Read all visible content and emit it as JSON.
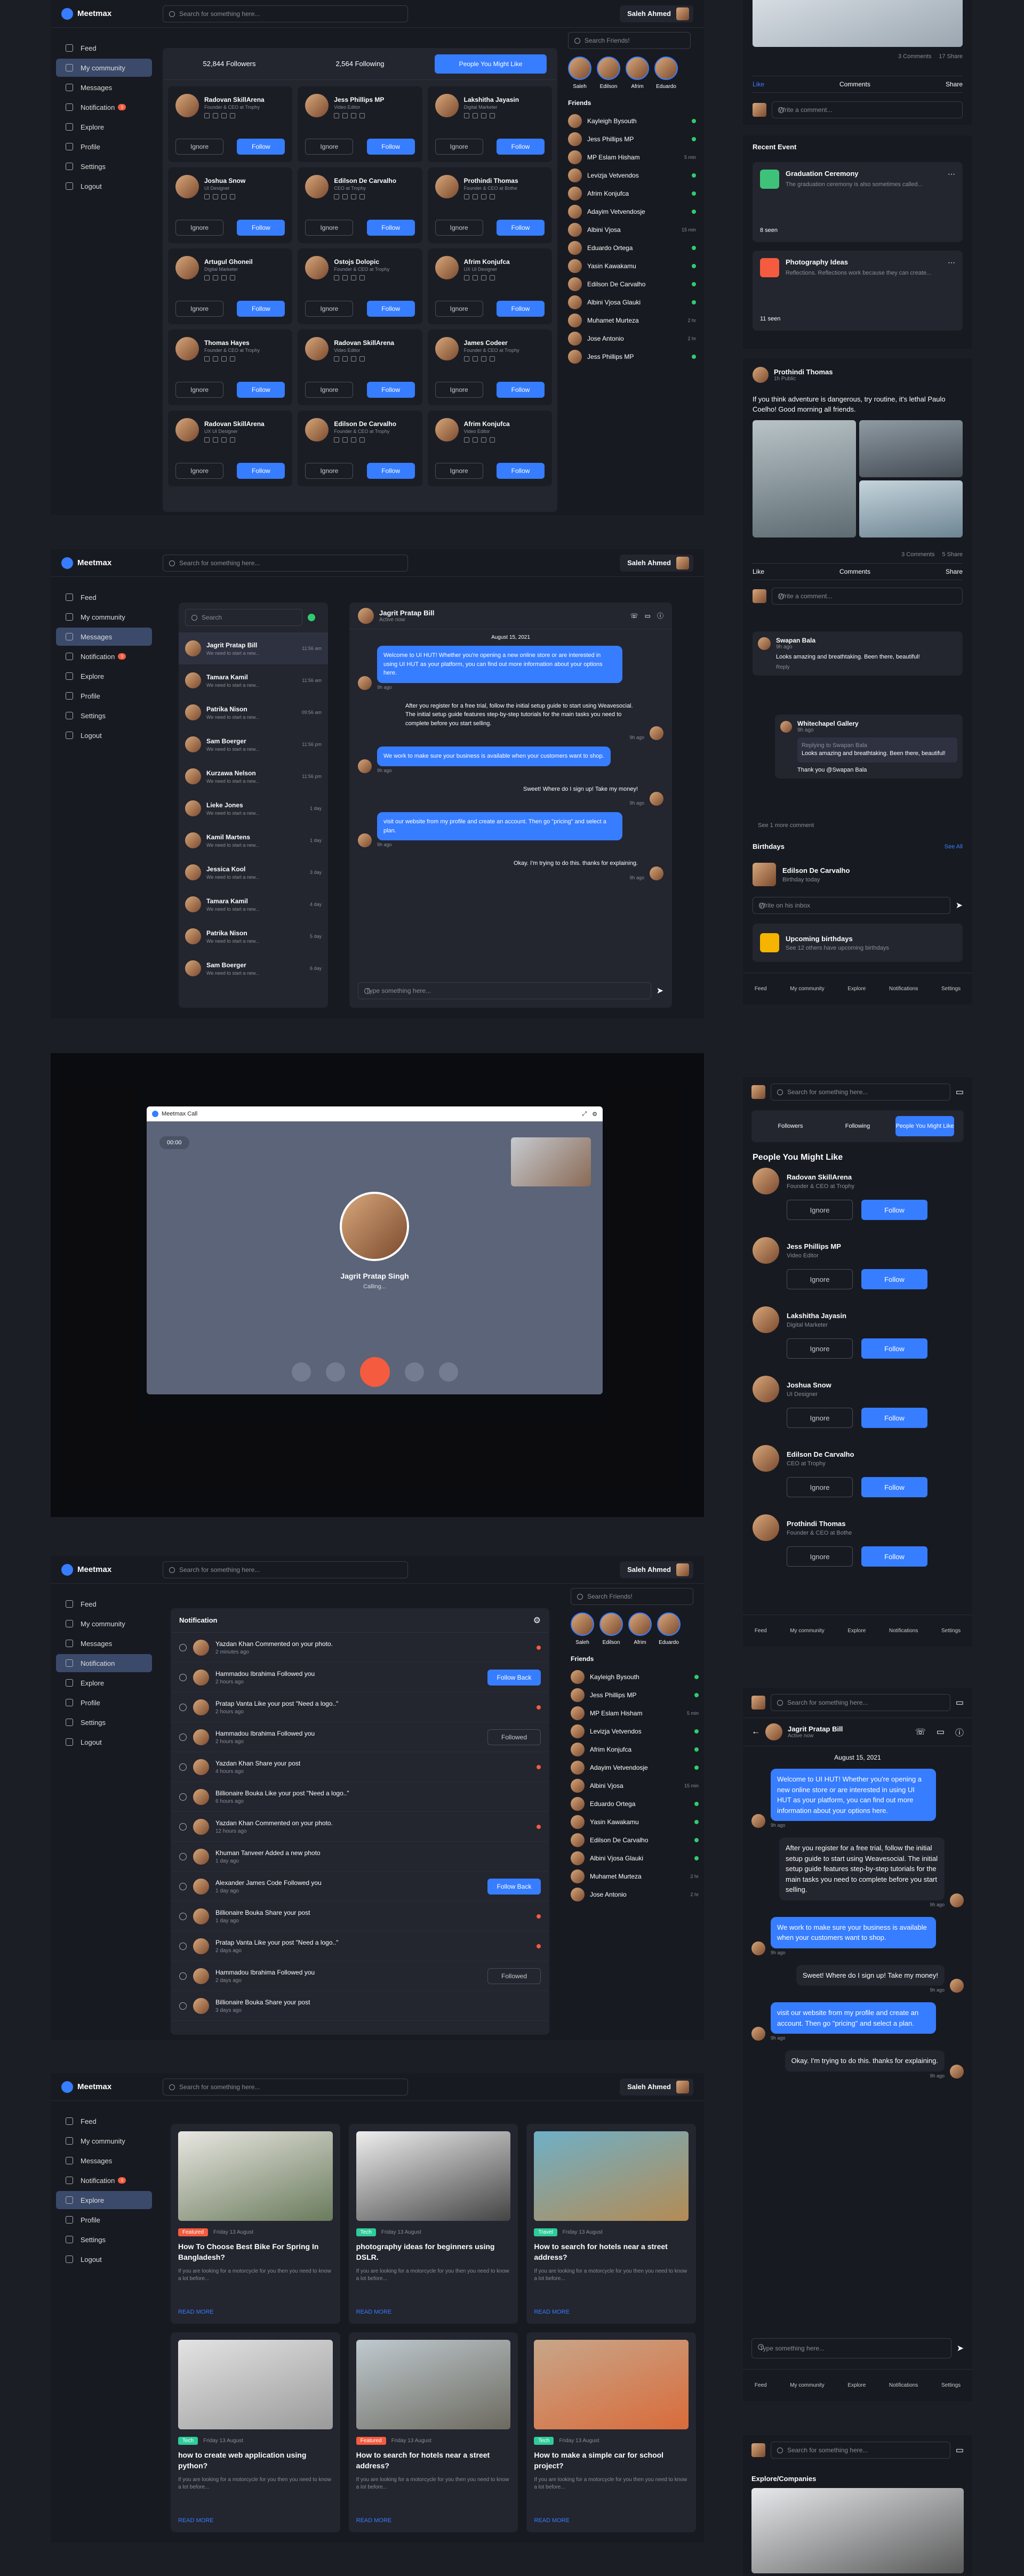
{
  "app": {
    "name": "Meetmax",
    "user": "Saleh Ahmed",
    "search_placeholder": "Search for something here...",
    "friends_placeholder": "Search Friends!"
  },
  "sidebar": [
    {
      "label": "Feed"
    },
    {
      "label": "My community"
    },
    {
      "label": "Messages"
    },
    {
      "label": "Notification"
    },
    {
      "label": "Explore"
    },
    {
      "label": "Profile"
    },
    {
      "label": "Settings"
    },
    {
      "label": "Logout"
    }
  ],
  "notif_badge": "9",
  "community": {
    "followers": "52,844 Followers",
    "following": "2,564 Following",
    "might_like": "People You Might Like",
    "ignore": "Ignore",
    "follow": "Follow",
    "people": [
      {
        "name": "Radovan SkillArena",
        "role": "Founder & CEO at Trophy"
      },
      {
        "name": "Jess Phillips MP",
        "role": "Video Editor"
      },
      {
        "name": "Lakshitha Jayasin",
        "role": "Digital Marketer"
      },
      {
        "name": "Joshua Snow",
        "role": "UI Designer"
      },
      {
        "name": "Edilson De Carvalho",
        "role": "CEO at Trophy"
      },
      {
        "name": "Prothindi Thomas",
        "role": "Founder & CEO at Bothe"
      },
      {
        "name": "Artugul Ghoneil",
        "role": "Digital Marketer"
      },
      {
        "name": "Ostojs Dolopic",
        "role": "Founder & CEO at Trophy"
      },
      {
        "name": "Afrim Konjufca",
        "role": "UX UI Designer"
      },
      {
        "name": "Thomas Hayes",
        "role": "Founder & CEO at Trophy"
      },
      {
        "name": "Radovan SkillArena",
        "role": "Video Editor"
      },
      {
        "name": "James Codeer",
        "role": "Founder & CEO at Trophy"
      },
      {
        "name": "Radovan SkillArena",
        "role": "UX UI Designer"
      },
      {
        "name": "Edilson De Carvalho",
        "role": "Founder & CEO at Trophy"
      },
      {
        "name": "Afrim Konjufca",
        "role": "Video Editor"
      }
    ]
  },
  "stories": [
    {
      "name": "Saleh"
    },
    {
      "name": "Edilson"
    },
    {
      "name": "Afrim"
    },
    {
      "name": "Eduardo"
    }
  ],
  "friends_title": "Friends",
  "friends": [
    {
      "name": "Kayleigh Bysouth",
      "t": ""
    },
    {
      "name": "Jess Phillips MP",
      "t": ""
    },
    {
      "name": "MP Eslam Hisham",
      "t": "5 min"
    },
    {
      "name": "Levizja Vetvendos",
      "t": ""
    },
    {
      "name": "Afrim Konjufca",
      "t": ""
    },
    {
      "name": "Adayim Vetvendosje",
      "t": ""
    },
    {
      "name": "Albini Vjosa",
      "t": "15 min"
    },
    {
      "name": "Eduardo Ortega",
      "t": ""
    },
    {
      "name": "Yasin Kawakamu",
      "t": ""
    },
    {
      "name": "Edilson De Carvalho",
      "t": ""
    },
    {
      "name": "Albini Vjosa Glauki",
      "t": ""
    },
    {
      "name": "Muhamet Murteza",
      "t": "2 hr"
    },
    {
      "name": "Jose Antonio",
      "t": "2 hr"
    },
    {
      "name": "Jess Phillips MP",
      "t": ""
    }
  ],
  "messages": {
    "search": "Search",
    "contact": "Jagrit Pratap Bill",
    "status": "Active now",
    "date": "August 15, 2021",
    "input": "Type something here...",
    "list": [
      {
        "name": "Jagrit Pratap Bill",
        "t": "11:56 am"
      },
      {
        "name": "Tamara Kamil",
        "t": "11:56 am"
      },
      {
        "name": "Patrika Nison",
        "t": "09:56 am"
      },
      {
        "name": "Sam Boerger",
        "t": "11:56 pm"
      },
      {
        "name": "Kurzawa Nelson",
        "t": "11:56 pm"
      },
      {
        "name": "Lieke Jones",
        "t": "1 day"
      },
      {
        "name": "Kamil Martens",
        "t": "1 day"
      },
      {
        "name": "Jessica Kool",
        "t": "3 day"
      },
      {
        "name": "Tamara Kamil",
        "t": "4 day"
      },
      {
        "name": "Patrika Nison",
        "t": "5 day"
      },
      {
        "name": "Sam Boerger",
        "t": "6 day"
      }
    ],
    "preview": "We need to start a new...",
    "chat": [
      {
        "me": false,
        "text": "Welcome to UI HUT! Whether you're opening a new online store or are interested in using UI HUT as your platform, you can find out more information about your options here.",
        "t": "9h ago"
      },
      {
        "me": true,
        "text": "After you register for a free trial, follow the initial setup guide to start using Weavesocial. The initial setup guide features step-by-step tutorials for the main tasks you need to complete before you start selling.",
        "t": "9h ago"
      },
      {
        "me": false,
        "text": "We work to make sure your business is available when your customers want to shop.",
        "t": "9h ago"
      },
      {
        "me": true,
        "text": "Sweet! Where do I sign up! Take my money!",
        "t": "9h ago"
      },
      {
        "me": false,
        "text": "visit our website from my profile and create an account. Then go \"pricing\" and select a plan.",
        "t": "9h ago"
      },
      {
        "me": true,
        "text": "Okay. I'm trying to do this. thanks for explaining.",
        "t": "9h ago"
      }
    ]
  },
  "call": {
    "title": "Meetmax Call",
    "timer": "00:00",
    "name": "Jagrit Pratap Singh",
    "status": "Calling..."
  },
  "notifications": {
    "title": "Notification",
    "follow_back": "Follow Back",
    "followed": "Followed",
    "items": [
      {
        "text": "Yazdan Khan Commented on your photo.",
        "t": "2 minutes ago"
      },
      {
        "text": "Hammadou Ibrahima Followed you",
        "t": "2 hours ago"
      },
      {
        "text": "Pratap Vanta Like your post \"Need a logo..\"",
        "t": "2 hours ago"
      },
      {
        "text": "Hammadou Ibrahima Followed you",
        "t": "2 hours ago"
      },
      {
        "text": "Yazdan Khan Share your post",
        "t": "4 hours ago"
      },
      {
        "text": "Billionaire Bouka Like your post \"Need a logo..\"",
        "t": "6 hours ago"
      },
      {
        "text": "Yazdan Khan Commented on your photo.",
        "t": "12 hours ago"
      },
      {
        "text": "Khuman Tanveer Added a new photo",
        "t": "1 day ago"
      },
      {
        "text": "Alexander James Code Followed you",
        "t": "1 day ago"
      },
      {
        "text": "Billionaire Bouka Share your post",
        "t": "1 day ago"
      },
      {
        "text": "Pratap Vanta Like your post \"Need a logo..\"",
        "t": "2 days ago"
      },
      {
        "text": "Hammadou Ibrahima Followed you",
        "t": "2 days ago"
      },
      {
        "text": "Billionaire Bouka Share your post",
        "t": "3 days ago"
      }
    ]
  },
  "explore": {
    "read_more": "READ MORE",
    "date": "Friday 13 August",
    "articles": [
      {
        "tag": "Featured",
        "title": "How To Choose Best Bike For Spring In Bangladesh?"
      },
      {
        "tag": "Tech",
        "title": "photography ideas for beginners using DSLR."
      },
      {
        "tag": "Travel",
        "title": "How to search for hotels near a street address?"
      },
      {
        "tag": "Tech",
        "title": "how to create web application using python?"
      },
      {
        "tag": "Featured",
        "title": "How to search for hotels near a street address?"
      },
      {
        "tag": "Tech",
        "title": "How to make a simple car for school project?"
      }
    ],
    "excerpt": "If you are looking for a motorcycle for you then you need to know a lot before..."
  },
  "feed": {
    "comments": "3 Comments",
    "shares": "17 Share",
    "like": "Like",
    "comments_l": "Comments",
    "share": "Share",
    "write": "Write a comment...",
    "recent_event": "Recent Event",
    "events": [
      {
        "title": "Graduation Ceremony",
        "desc": "The graduation ceremony is also sometimes called...",
        "seen": "8 seen"
      },
      {
        "title": "Photography Ideas",
        "desc": "Reflections. Reflections work because they can create...",
        "seen": "11 seen"
      }
    ],
    "post_author": "Prothindi Thomas",
    "post_time": "1h Public",
    "post_text": "If you think adventure is dangerous, try routine, it's lethal Paulo Coelho! Good morning all friends.",
    "post_comments": "3 Comments",
    "post_shares": "5 Share",
    "c1_author": "Swapan Bala",
    "c1_time": "9h ago",
    "c1_text": "Looks amazing and breathtaking. Been there, beautiful!",
    "reply": "Reply",
    "c2_author": "Whitechapel Gallery",
    "c2_time": "9h ago",
    "c2_reply": "Replying to Swapan Bala",
    "c2_text": "Looks amazing and breathtaking. Been there, beautiful!",
    "c2_thanks": "Thank you @Swapan Bala",
    "see_more": "See 1 more comment",
    "birthdays": "Birthdays",
    "see_all": "See All",
    "bday_name": "Edilson De Carvalho",
    "bday_sub": "Birthday today",
    "inbox": "Write on his inbox",
    "upcoming": "Upcoming birthdays",
    "upcoming_sub": "See 12 others have upcoming birthdays"
  },
  "mobile_nav": [
    "Feed",
    "My community",
    "Explore",
    "Notifications",
    "Settings"
  ],
  "mobile_tabs": [
    "Followers",
    "Following",
    "People You Might Like"
  ],
  "mobile_pyml": "People You Might Like",
  "mobile_explore": "Explore/Companies"
}
